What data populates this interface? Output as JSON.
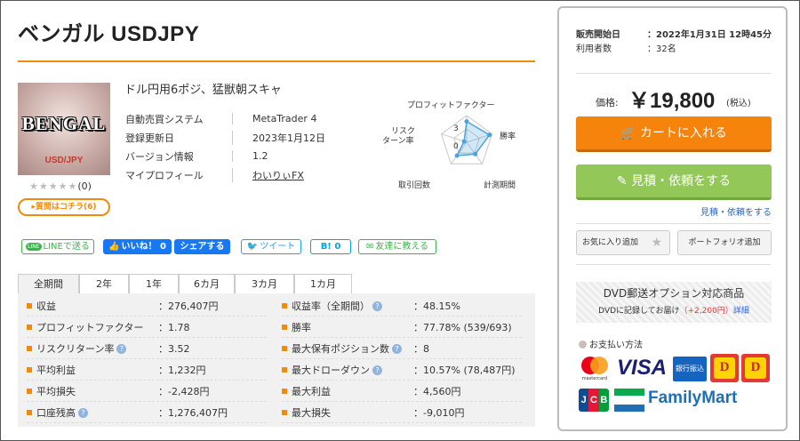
{
  "product": {
    "title": "ベンガル USDJPY",
    "logo_main": "BENGAL",
    "logo_sub": "USD/JPY",
    "rating_stars": "★★★★★",
    "rating_count": "(0)",
    "question_button": "▸質問はコチラ(6)",
    "catchphrase": "ドル円用6ポジ、猛獣朝スキャ",
    "info": [
      {
        "key": "自動売買システム",
        "value": "MetaTrader 4"
      },
      {
        "key": "登録更新日",
        "value": "2023年1月12日"
      },
      {
        "key": "バージョン情報",
        "value": "1.2"
      },
      {
        "key": "マイプロフィール",
        "value": "わいりぃFX"
      }
    ]
  },
  "radar": {
    "labels": {
      "top": "プロフィットファクター",
      "right": "勝率",
      "bottom_right": "計測期間",
      "bottom_left": "取引回数",
      "left_line1": "リスク",
      "left_line2": "ターン率"
    },
    "scale": {
      "outer": "3",
      "inner": "0"
    },
    "values": {
      "pf": 0.78,
      "win": 0.9,
      "period": 0.55,
      "trades": 0.62,
      "risk": 0.1
    },
    "colors": {
      "line": "#4aa3df",
      "fill": "#4aa3df",
      "grid": "#c8c8c8"
    }
  },
  "share": {
    "line": "LINEで送る",
    "line_icon": "LINE",
    "like": "いいね！ 0",
    "fb_share": "シェアする",
    "tweet": "ツイート",
    "hatena": "B! 0",
    "mail": "友達に教える"
  },
  "tabs": [
    "全期間",
    "2年",
    "1年",
    "6カ月",
    "3カ月",
    "1カ月"
  ],
  "stats": {
    "left": [
      {
        "label": "収益",
        "value": "：276,407円",
        "help": false
      },
      {
        "label": "プロフィットファクター",
        "value": "：1.78",
        "help": false
      },
      {
        "label": "リスクリターン率",
        "value": "：3.52",
        "help": true
      },
      {
        "label": "平均利益",
        "value": "：1,232円",
        "help": false
      },
      {
        "label": "平均損失",
        "value": "：-2,428円",
        "help": false
      },
      {
        "label": "口座残高",
        "value": "：1,276,407円",
        "help": true
      }
    ],
    "right": [
      {
        "label": "収益率（全期間）",
        "value": "：48.15%",
        "help": true
      },
      {
        "label": "勝率",
        "value": "：77.78% (539/693)",
        "help": false
      },
      {
        "label": "最大保有ポジション数",
        "value": "：8",
        "help": true
      },
      {
        "label": "最大ドローダウン",
        "value": "：10.57% (78,487円)",
        "help": true
      },
      {
        "label": "最大利益",
        "value": "：4,560円",
        "help": false
      },
      {
        "label": "最大損失",
        "value": "：-9,010円",
        "help": false
      }
    ]
  },
  "sidebar": {
    "sale_start_label": "販売開始日",
    "sale_start_value": "：2022年1月31日 12時45分",
    "users_label": "利用者数",
    "users_value": "：32名",
    "price_label": "価格:",
    "price": "￥19,800",
    "tax": "(税込)",
    "cart_button": "カートに入れる",
    "quote_button": "見積・依頼をする",
    "quote_link": "見積・依頼をする",
    "favorite_button": "お気に入り追加",
    "portfolio_button": "ポートフォリオ追加",
    "dvd_title": "DVD郵送オプション対応商品",
    "dvd_text": "DVDに記録してお届け",
    "dvd_price": "（+2,200円）",
    "dvd_detail": "詳細",
    "payment_title": "お支払い方法",
    "payment": {
      "mastercard": "mastercard",
      "visa": "VISA",
      "bank": "銀行振込",
      "jcb": "JCB",
      "familymart": "FamilyMart"
    }
  },
  "colors": {
    "accent": "#f08a0c",
    "cart": "#f6830b",
    "quote": "#93c858",
    "link": "#2b66c0"
  }
}
